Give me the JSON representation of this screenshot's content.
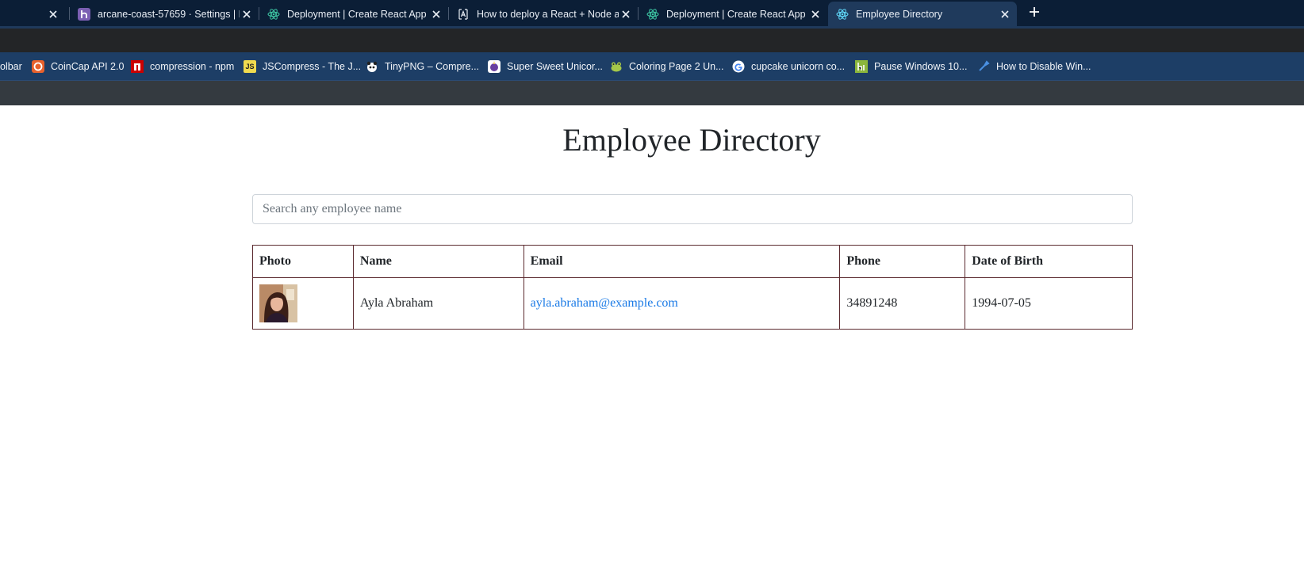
{
  "browser": {
    "tabs": [
      {
        "title": "",
        "favicon": "none",
        "active": false
      },
      {
        "title": "arcane-coast-57659 · Settings | H",
        "favicon": "heroku-icon",
        "active": false
      },
      {
        "title": "Deployment | Create React App",
        "favicon": "react-icon",
        "active": false
      },
      {
        "title": "How to deploy a React + Node a",
        "favicon": "angular-icon",
        "active": false
      },
      {
        "title": "Deployment | Create React App",
        "favicon": "react-icon",
        "active": false
      },
      {
        "title": "Employee Directory",
        "favicon": "react-icon",
        "active": true
      }
    ],
    "new_tab_icon": "plus-icon",
    "close_icon": "close-icon",
    "bookmarks": [
      {
        "label": "olbar",
        "icon": "none"
      },
      {
        "label": "CoinCap API 2.0",
        "icon": "coincap-icon"
      },
      {
        "label": "compression - npm",
        "icon": "npm-icon"
      },
      {
        "label": "JSCompress - The J...",
        "icon": "js-icon",
        "icon_text": "JS"
      },
      {
        "label": "TinyPNG – Compre...",
        "icon": "panda-icon"
      },
      {
        "label": "Super Sweet Unicor...",
        "icon": "unicorn-icon"
      },
      {
        "label": "Coloring Page 2 Un...",
        "icon": "frog-icon"
      },
      {
        "label": "cupcake unicorn co...",
        "icon": "google-icon"
      },
      {
        "label": "Pause Windows 10...",
        "icon": "howtogeek-icon"
      },
      {
        "label": "How to Disable Win...",
        "icon": "tool-icon"
      }
    ]
  },
  "app": {
    "title": "Employee Directory",
    "search": {
      "placeholder": "Search any employee name",
      "value": ""
    },
    "table": {
      "headers": [
        "Photo",
        "Name",
        "Email",
        "Phone",
        "Date of Birth"
      ],
      "rows": [
        {
          "name": "Ayla Abraham",
          "email": "ayla.abraham@example.com",
          "phone": "34891248",
          "dob": "1994-07-05",
          "photo": "avatar"
        }
      ]
    }
  },
  "colors": {
    "tab_bar": "#0b1e36",
    "active_tab": "#1f3a5c",
    "bookmarks_bar": "#1d3e66",
    "navbar": "#343a40",
    "link": "#1a7ae6",
    "table_border": "#5b2a2f"
  }
}
